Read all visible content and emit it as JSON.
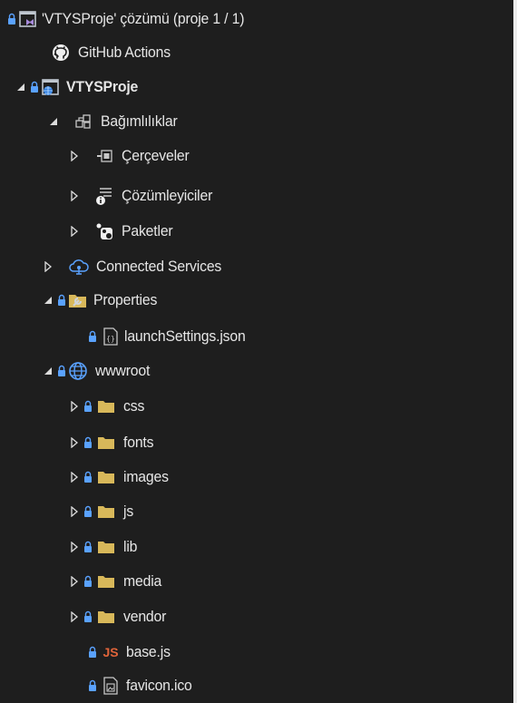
{
  "solution": {
    "label": "'VTYSProje' çözümü (proje 1 / 1)"
  },
  "github": {
    "label": "GitHub Actions"
  },
  "project": {
    "label": "VTYSProje"
  },
  "dependencies": {
    "label": "Bağımlılıklar",
    "items": [
      {
        "label": "Çerçeveler"
      },
      {
        "label": "Çözümleyiciler"
      },
      {
        "label": "Paketler"
      }
    ]
  },
  "connected": {
    "label": "Connected Services"
  },
  "properties": {
    "label": "Properties",
    "items": [
      {
        "label": "launchSettings.json"
      }
    ]
  },
  "wwwroot": {
    "label": "wwwroot",
    "folders": [
      {
        "label": "css"
      },
      {
        "label": "fonts"
      },
      {
        "label": "images"
      },
      {
        "label": "js"
      },
      {
        "label": "lib"
      },
      {
        "label": "media"
      },
      {
        "label": "vendor"
      }
    ],
    "files": [
      {
        "label": "base.js",
        "badge": "JS"
      },
      {
        "label": "favicon.ico"
      }
    ]
  },
  "colors": {
    "background": "#1e1e1e",
    "text": "#e4e4e4",
    "lock": "#5aa2ff",
    "folder": "#d8b85a",
    "js": "#e0643a",
    "github": "#f0f0f0"
  }
}
